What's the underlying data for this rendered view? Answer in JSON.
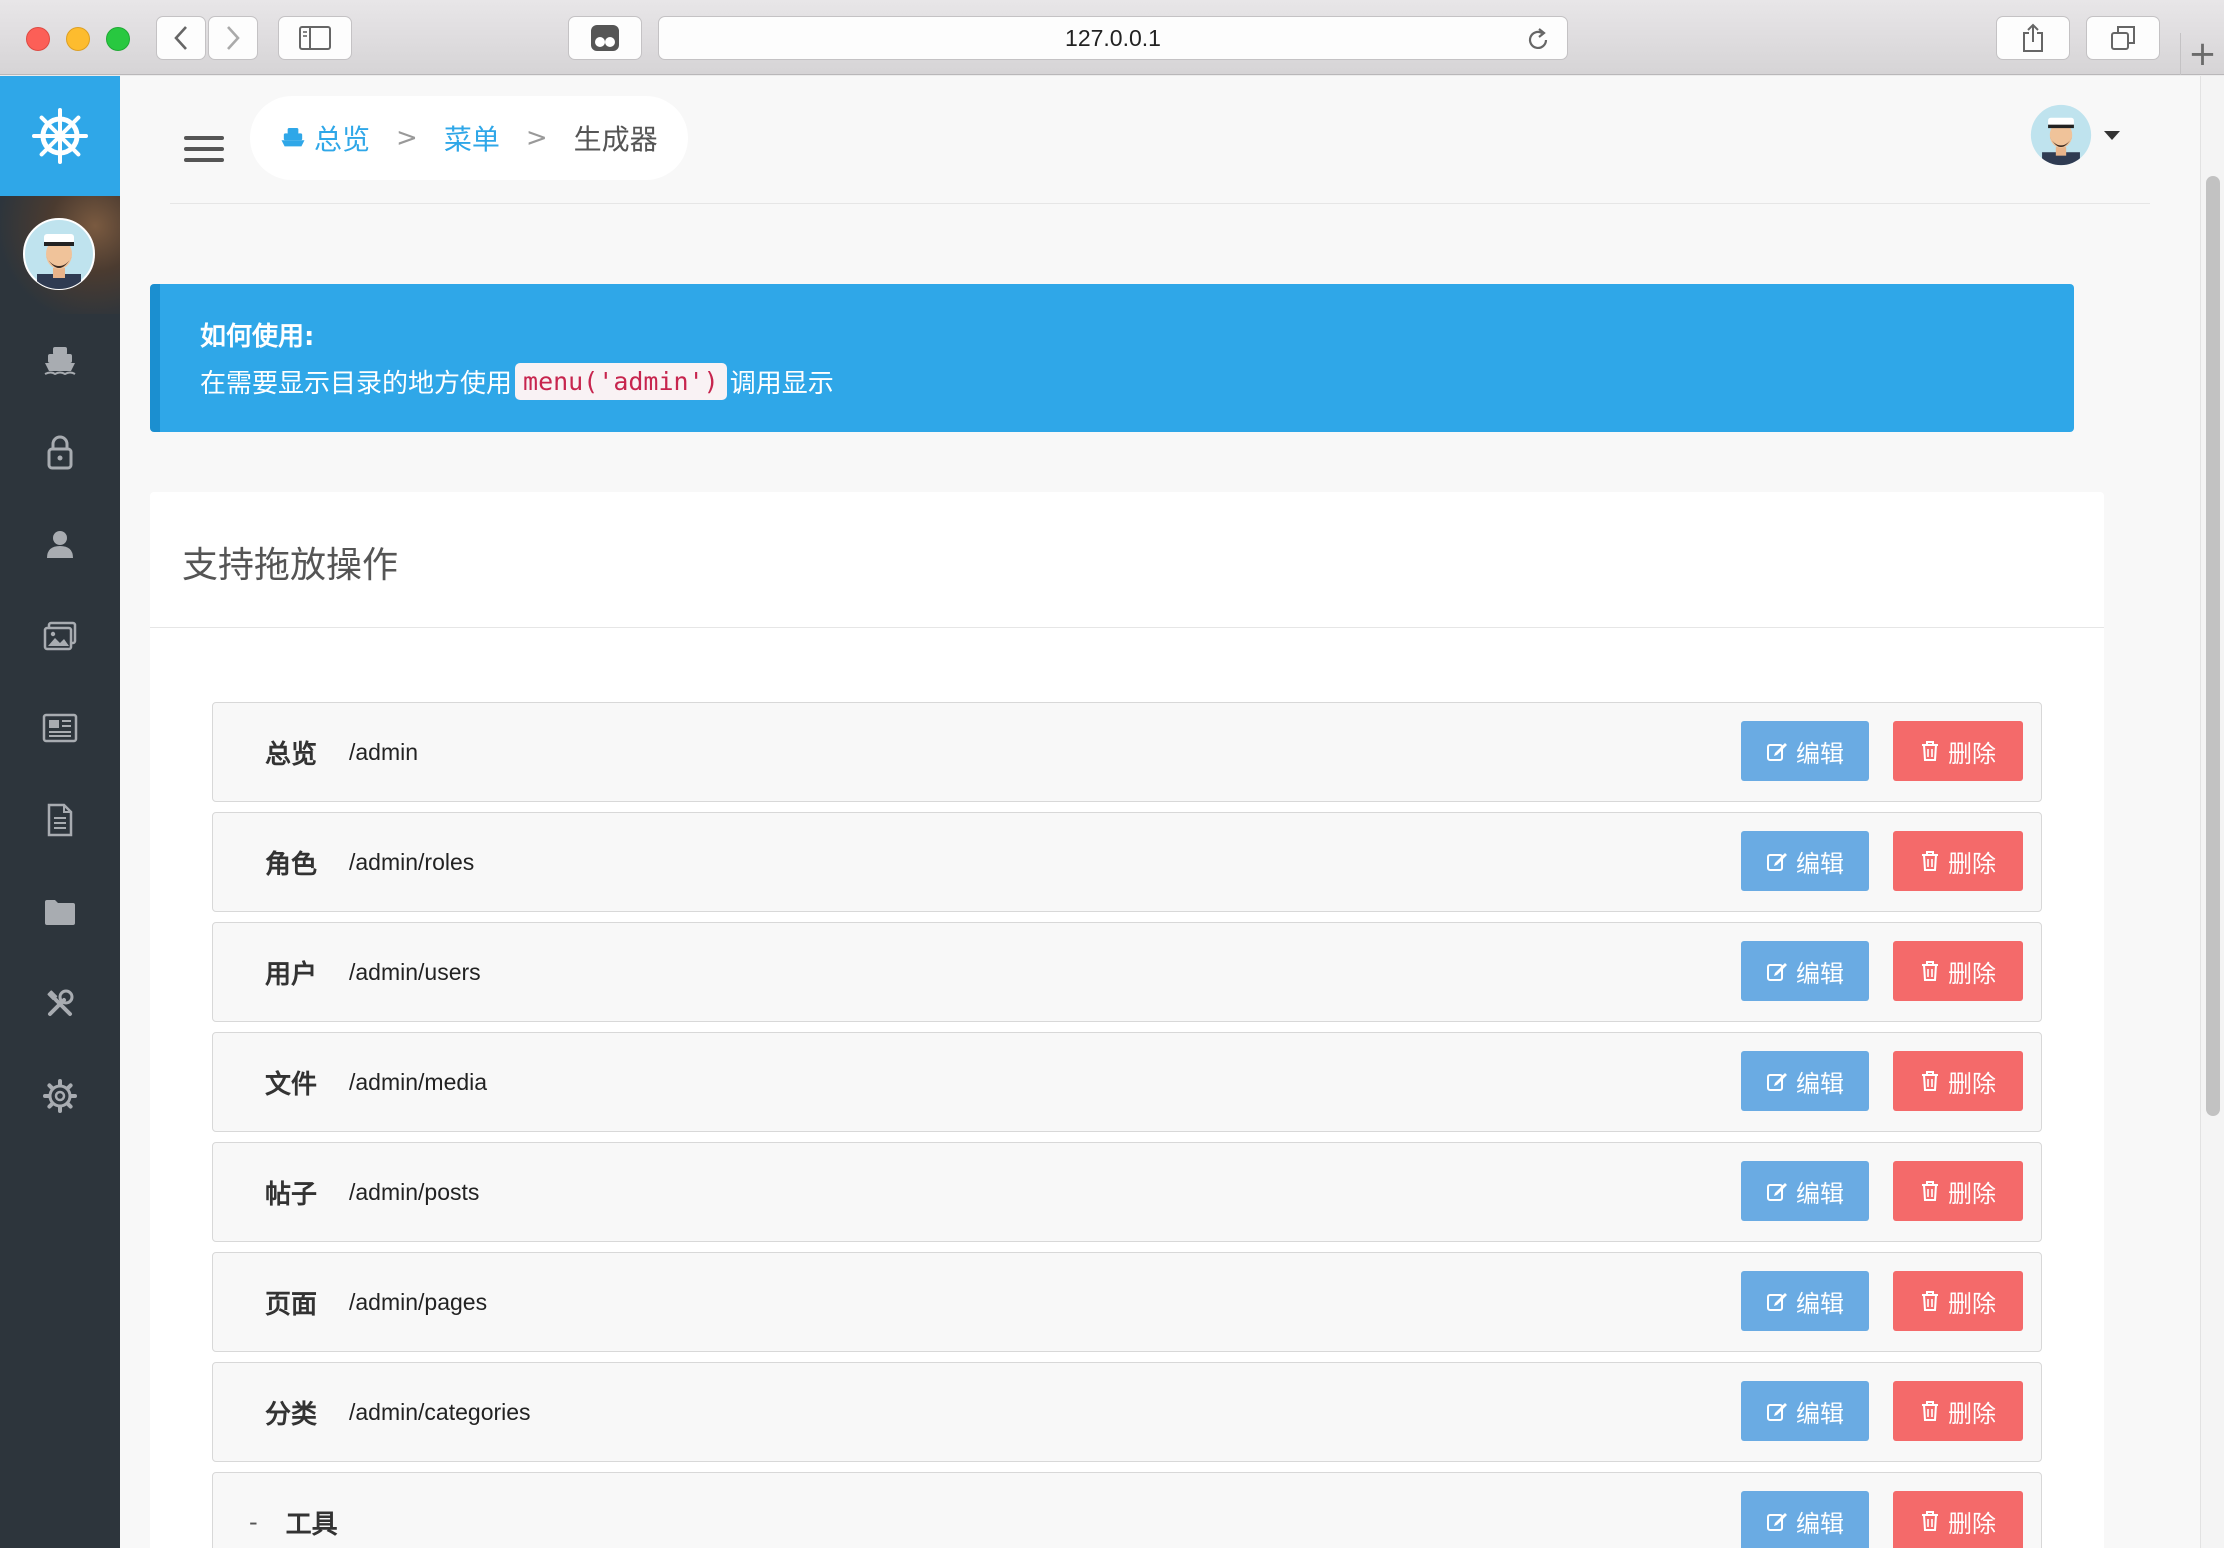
{
  "browser": {
    "url": "127.0.0.1",
    "new_tab_symbol": "+"
  },
  "sidebar": {
    "logo_icon": "ship-wheel-icon",
    "accent_color": "#2fa7e8",
    "items": [
      {
        "icon": "ship-icon"
      },
      {
        "icon": "lock-icon"
      },
      {
        "icon": "user-icon"
      },
      {
        "icon": "images-icon"
      },
      {
        "icon": "newspaper-icon"
      },
      {
        "icon": "file-icon"
      },
      {
        "icon": "folder-icon"
      },
      {
        "icon": "tools-icon"
      },
      {
        "icon": "gear-icon"
      }
    ]
  },
  "breadcrumb": {
    "home": "总览",
    "menu": "菜单",
    "current": "生成器",
    "separator": ">"
  },
  "alert": {
    "title": "如何使用:",
    "prefix": "在需要显示目录的地方使用",
    "code": "menu('admin')",
    "suffix": "调用显示"
  },
  "card": {
    "title": "支持拖放操作"
  },
  "buttons": {
    "edit": "编辑",
    "delete": "删除"
  },
  "menu_items": [
    {
      "title": "总览",
      "url": "/admin"
    },
    {
      "title": "角色",
      "url": "/admin/roles"
    },
    {
      "title": "用户",
      "url": "/admin/users"
    },
    {
      "title": "文件",
      "url": "/admin/media"
    },
    {
      "title": "帖子",
      "url": "/admin/posts"
    },
    {
      "title": "页面",
      "url": "/admin/pages"
    },
    {
      "title": "分类",
      "url": "/admin/categories"
    },
    {
      "title": "工具",
      "url": "",
      "collapse": "-"
    }
  ]
}
